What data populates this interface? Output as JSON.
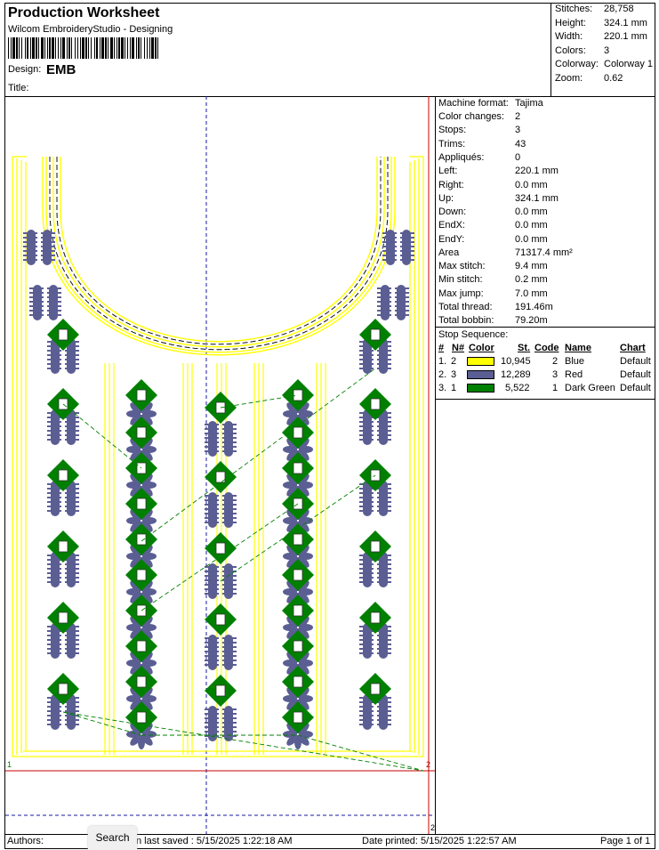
{
  "header": {
    "title": "Production Worksheet",
    "subtitle": "Wilcom EmbroideryStudio - Designing",
    "design_label": "Design:",
    "design_value": "EMB",
    "title_label": "Title:"
  },
  "stats": [
    {
      "label": "Stitches:",
      "value": "28,758"
    },
    {
      "label": "Height:",
      "value": "324.1 mm"
    },
    {
      "label": "Width:",
      "value": "220.1 mm"
    },
    {
      "label": "Colors:",
      "value": "3"
    },
    {
      "label": "Colorway:",
      "value": "Colorway 1"
    },
    {
      "label": "Zoom:",
      "value": "0.62"
    }
  ],
  "info": [
    {
      "label": "Machine format:",
      "value": "Tajima"
    },
    {
      "label": "Color changes:",
      "value": "2"
    },
    {
      "label": "Stops:",
      "value": "3"
    },
    {
      "label": "Trims:",
      "value": "43"
    },
    {
      "label": "Appliqués:",
      "value": "0"
    },
    {
      "label": "Left:",
      "value": "220.1 mm"
    },
    {
      "label": "Right:",
      "value": "0.0 mm"
    },
    {
      "label": "Up:",
      "value": "324.1 mm"
    },
    {
      "label": "Down:",
      "value": "0.0 mm"
    },
    {
      "label": "EndX:",
      "value": "0.0 mm"
    },
    {
      "label": "EndY:",
      "value": "0.0 mm"
    },
    {
      "label": "Area",
      "value": "71317.4 mm²"
    },
    {
      "label": "Max stitch:",
      "value": "9.4 mm"
    },
    {
      "label": "Min stitch:",
      "value": "0.2 mm"
    },
    {
      "label": "Max jump:",
      "value": "7.0 mm"
    },
    {
      "label": "Total thread:",
      "value": "191.46m"
    },
    {
      "label": "Total bobbin:",
      "value": "79.20m"
    }
  ],
  "stop_sequence": {
    "title": "Stop Sequence:",
    "headers": {
      "num": "#",
      "n": "N#",
      "color": "Color",
      "st": "St.",
      "code": "Code",
      "name": "Name",
      "chart": "Chart"
    },
    "rows": [
      {
        "num": "1.",
        "n": "2",
        "color": "#ffff00",
        "st": "10,945",
        "code": "2",
        "name": "Blue",
        "chart": "Default"
      },
      {
        "num": "2.",
        "n": "3",
        "color": "#5b5e93",
        "st": "12,289",
        "code": "3",
        "name": "Red",
        "chart": "Default"
      },
      {
        "num": "3.",
        "n": "1",
        "color": "#008000",
        "st": "5,522",
        "code": "1",
        "name": "Dark Green",
        "chart": "Default"
      }
    ]
  },
  "canvas": {
    "marker_start": "1",
    "marker_end": "2",
    "marker_end_bottom": "2",
    "colors": {
      "yellow": "#ffff00",
      "blue": "#5b5e93",
      "green": "#008000",
      "red": "#cc0000",
      "guide": "#1a1aa0"
    }
  },
  "footer": {
    "authors": "Authors:",
    "last_saved": "n last saved : 5/15/2025 1:22:18 AM",
    "printed": "Date printed: 5/15/2025 1:22:57 AM",
    "page": "Page 1 of 1"
  },
  "search_button": "Search"
}
